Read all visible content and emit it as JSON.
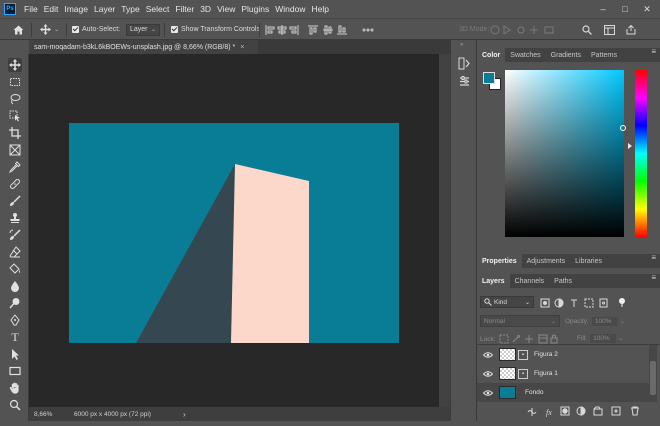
{
  "app": {
    "logo": "Ps"
  },
  "menu": [
    "File",
    "Edit",
    "Image",
    "Layer",
    "Type",
    "Select",
    "Filter",
    "3D",
    "View",
    "Plugins",
    "Window",
    "Help"
  ],
  "window_controls": {
    "minimize": "–",
    "maximize": "□",
    "close": "✕"
  },
  "options_bar": {
    "auto_select_label": "Auto-Select:",
    "auto_select_checked": true,
    "target_value": "Layer",
    "transform_controls_label": "Show Transform Controls",
    "transform_controls_checked": true,
    "mode_3d_label": "3D Mode:"
  },
  "document": {
    "tab_title": "sam-moqadam-b3kL6kBOEWs-unsplash.jpg @ 8,66% (RGB/8) *",
    "close_glyph": "×",
    "zoom": "8,66%",
    "dimensions": "6000 px x 4000 px (72 ppi)",
    "status_arrow": "›"
  },
  "canvas_colors": {
    "background": "#0a7d96",
    "shadow": "#354750",
    "building": "#fcd8ca"
  },
  "color_panel": {
    "tabs": [
      "Color",
      "Swatches",
      "Gradients",
      "Patterns"
    ],
    "active_tab": "Color",
    "foreground": "#0a7d96",
    "background": "#ffffff",
    "hue": "#00c8ff"
  },
  "properties_panel": {
    "tabs": [
      "Properties",
      "Adjustments",
      "Libraries"
    ],
    "active_tab": "Properties"
  },
  "layers_panel": {
    "tabs": [
      "Layers",
      "Channels",
      "Paths"
    ],
    "active_tab": "Layers",
    "filter_label": "Kind",
    "blend_mode": "Normal",
    "opacity_label": "Opacity:",
    "opacity_value": "100%",
    "lock_label": "Lock:",
    "fill_label": "Fill:",
    "fill_value": "100%",
    "layers": [
      {
        "name": "Figura 2",
        "thumb": "transparent"
      },
      {
        "name": "Figura 1",
        "thumb": "transparent"
      },
      {
        "name": "Fondo",
        "thumb": "#0a7d96"
      }
    ]
  }
}
